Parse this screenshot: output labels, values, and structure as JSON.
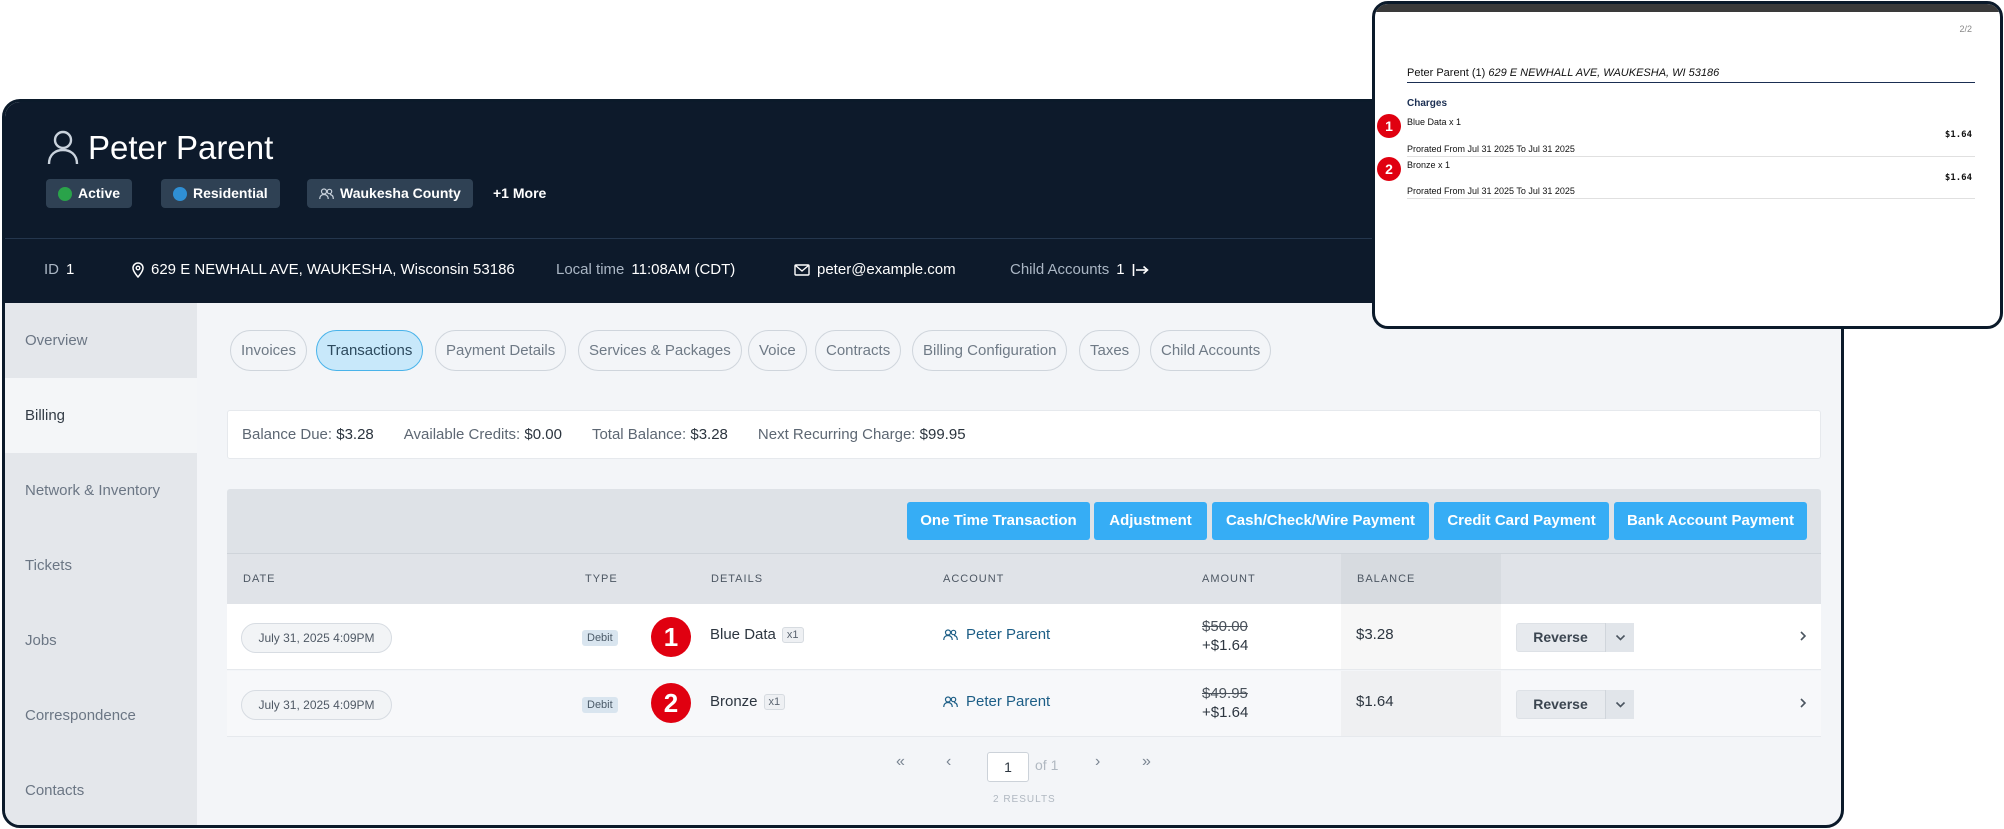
{
  "header": {
    "name": "Peter Parent",
    "badges": [
      {
        "label": "Active",
        "dot_color": "#2aa34a"
      },
      {
        "label": "Residential",
        "dot_color": "#2f8fd4"
      },
      {
        "label": "Waukesha County"
      }
    ],
    "more_label": "+1 More"
  },
  "info": {
    "id_label": "ID",
    "id_value": "1",
    "address": "629 E NEWHALL AVE, WAUKESHA, Wisconsin 53186",
    "local_time_label": "Local time",
    "local_time_value": "11:08AM (CDT)",
    "email": "peter@example.com",
    "child_accounts_label": "Child Accounts",
    "child_accounts_value": "1"
  },
  "sidebar": {
    "items": [
      {
        "label": "Overview"
      },
      {
        "label": "Billing"
      },
      {
        "label": "Network & Inventory"
      },
      {
        "label": "Tickets"
      },
      {
        "label": "Jobs"
      },
      {
        "label": "Correspondence"
      },
      {
        "label": "Contacts"
      }
    ]
  },
  "tabs": [
    {
      "label": "Invoices"
    },
    {
      "label": "Transactions"
    },
    {
      "label": "Payment Details"
    },
    {
      "label": "Services & Packages"
    },
    {
      "label": "Voice"
    },
    {
      "label": "Contracts"
    },
    {
      "label": "Billing Configuration"
    },
    {
      "label": "Taxes"
    },
    {
      "label": "Child Accounts"
    }
  ],
  "balance": {
    "due_label": "Balance Due:",
    "due_value": "$3.28",
    "credits_label": "Available Credits:",
    "credits_value": "$0.00",
    "total_label": "Total Balance:",
    "total_value": "$3.28",
    "next_label": "Next Recurring Charge:",
    "next_value": "$99.95"
  },
  "actions": [
    {
      "label": "One Time Transaction"
    },
    {
      "label": "Adjustment"
    },
    {
      "label": "Cash/Check/Wire Payment"
    },
    {
      "label": "Credit Card Payment"
    },
    {
      "label": "Bank Account Payment"
    }
  ],
  "table": {
    "columns": [
      "DATE",
      "TYPE",
      "DETAILS",
      "ACCOUNT",
      "AMOUNT",
      "BALANCE"
    ],
    "rows": [
      {
        "date": "July 31, 2025 4:09PM",
        "type": "Debit",
        "marker": "1",
        "details": "Blue Data",
        "qty": "x1",
        "account": "Peter Parent",
        "amount_old": "$50.00",
        "amount": "+$1.64",
        "balance": "$3.28",
        "action": "Reverse"
      },
      {
        "date": "July 31, 2025 4:09PM",
        "type": "Debit",
        "marker": "2",
        "details": "Bronze",
        "qty": "x1",
        "account": "Peter Parent",
        "amount_old": "$49.95",
        "amount": "+$1.64",
        "balance": "$1.64",
        "action": "Reverse"
      }
    ]
  },
  "pagination": {
    "first": "«",
    "prev": "‹",
    "page": "1",
    "of": "of 1",
    "next": "›",
    "last": "»",
    "results": "2 RESULTS"
  },
  "invoice": {
    "page": "2/2",
    "customer": "Peter Parent (1)",
    "address": "629 E NEWHALL AVE, WAUKESHA, WI 53186",
    "charges_label": "Charges",
    "lines": [
      {
        "marker": "1",
        "item": "Blue Data x 1",
        "price": "$1.64",
        "note": "Prorated From Jul 31 2025 To Jul 31 2025"
      },
      {
        "marker": "2",
        "item": "Bronze x 1",
        "price": "$1.64",
        "note": "Prorated From Jul 31 2025 To Jul 31 2025"
      }
    ]
  },
  "colors": {
    "header_bg": "#0d1a2b",
    "accent": "#36adf5",
    "marker_red": "#e00010"
  }
}
